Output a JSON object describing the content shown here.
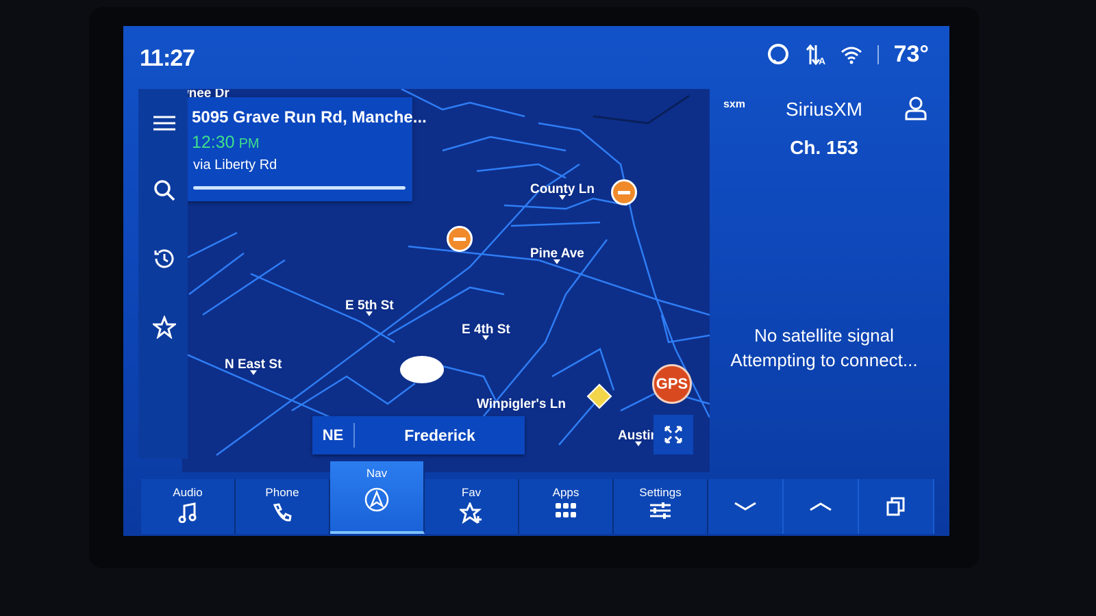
{
  "status_bar": {
    "time": "11:27",
    "temperature": "73°",
    "icons": [
      "alexa-ring-icon",
      "data-transfer-icon",
      "wifi-icon"
    ]
  },
  "sidebar": {
    "items": [
      "menu-icon",
      "search-icon",
      "recent-history-icon",
      "favorites-star-icon"
    ]
  },
  "route_card": {
    "destination": "5095 Grave Run Rd, Manche...",
    "eta_time": "12:30",
    "eta_ampm": "PM",
    "via": "via Liberty Rd",
    "progress": 1.0
  },
  "map": {
    "street_labels": {
      "shawnee": "Shawnee Dr",
      "county": "County Ln",
      "pine": "Pine Ave",
      "e5th": "E 5th St",
      "e4th": "E 4th St",
      "neast": "N East St",
      "winpigler": "Winpigler's Ln",
      "austin": "Austin"
    },
    "gps_badge": "GPS",
    "heading": "NE",
    "city": "Frederick",
    "colors": {
      "road": "#2f7df5",
      "hazard": "#f08a2a",
      "gps_warning": "#d9491f"
    }
  },
  "media": {
    "source_logo": "sxm",
    "source": "SiriusXM",
    "channel": "Ch. 153",
    "message_line1": "No satellite signal",
    "message_line2": "Attempting to connect..."
  },
  "bottom_bar": {
    "tabs": [
      {
        "label": "Audio",
        "icon": "music-note-icon"
      },
      {
        "label": "Phone",
        "icon": "phone-icon"
      },
      {
        "label": "Nav",
        "icon": "navigation-arrow-icon",
        "active": true
      },
      {
        "label": "Fav",
        "icon": "star-plus-icon"
      },
      {
        "label": "Apps",
        "icon": "apps-grid-icon"
      },
      {
        "label": "Settings",
        "icon": "sliders-icon"
      }
    ]
  }
}
